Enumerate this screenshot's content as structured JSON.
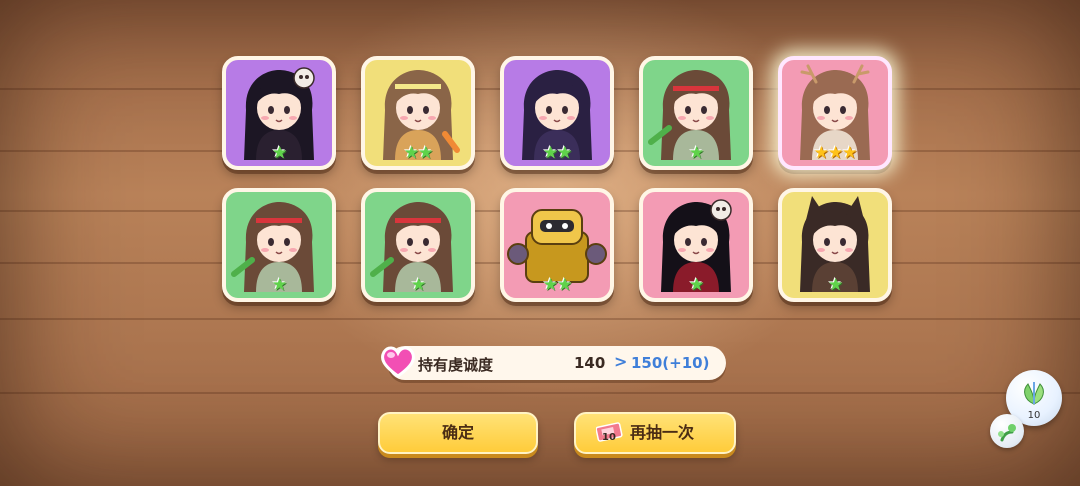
{
  "cards": [
    {
      "bg": "#b77be6",
      "stars": 1,
      "hair": "#1c1624",
      "skin": "#fde4d4",
      "outfit": "#2a2030",
      "accessory": "skull"
    },
    {
      "bg": "#f1df7a",
      "stars": 2,
      "hair": "#8a6548",
      "skin": "#fde4d4",
      "outfit": "#d9a35a",
      "accessory": "headband-yellow"
    },
    {
      "bg": "#b77be6",
      "stars": 2,
      "hair": "#2a2042",
      "skin": "#fde4d4",
      "outfit": "#3b2e5a",
      "accessory": "none"
    },
    {
      "bg": "#7fd58a",
      "stars": 1,
      "hair": "#6b4a38",
      "skin": "#fde4d4",
      "outfit": "#a8b89a",
      "accessory": "headband-red"
    },
    {
      "bg": "#f39bb4",
      "stars": 3,
      "hair": "#9a6a52",
      "skin": "#fde4d4",
      "outfit": "#e7d7c7",
      "accessory": "antlers",
      "highlight": true
    },
    {
      "bg": "#7fd58a",
      "stars": 1,
      "hair": "#6b4a38",
      "skin": "#fde4d4",
      "outfit": "#a8b89a",
      "accessory": "headband-red"
    },
    {
      "bg": "#7fd58a",
      "stars": 1,
      "hair": "#6b4a38",
      "skin": "#fde4d4",
      "outfit": "#a8b89a",
      "accessory": "headband-red"
    },
    {
      "bg": "#f39bb4",
      "stars": 2,
      "hair": "#e0b92a",
      "skin": "#f0c64a",
      "outfit": "#c7981e",
      "accessory": "mech"
    },
    {
      "bg": "#f39bb4",
      "stars": 1,
      "hair": "#141018",
      "skin": "#fde4d4",
      "outfit": "#8a1b2a",
      "accessory": "skull"
    },
    {
      "bg": "#f1df7a",
      "stars": 1,
      "hair": "#3a2a26",
      "skin": "#fde4d4",
      "outfit": "#5a4034",
      "accessory": "wolf-ears"
    }
  ],
  "devotion": {
    "label": "持有虔诚度",
    "current": "140",
    "arrow": ">",
    "next": "150(+10)"
  },
  "buttons": {
    "confirm": "确定",
    "draw_again": "再抽一次",
    "ticket_count": "10"
  },
  "side": {
    "bubble_count": "10"
  },
  "colors": {
    "button_fill": "#ffcc3a",
    "star_green": "#5fd34a",
    "star_gold": "#ffc21a",
    "accent_blue": "#3f7fd9"
  }
}
